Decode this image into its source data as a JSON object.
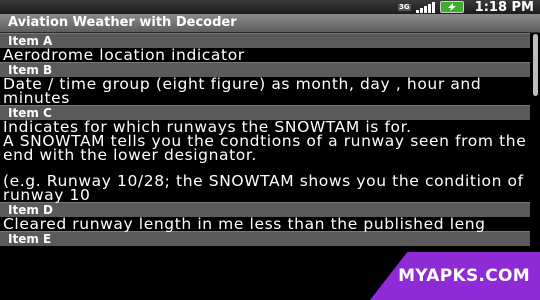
{
  "status_bar": {
    "network_label": "3G",
    "time": "1:18 PM"
  },
  "app": {
    "title": "Aviation Weather with Decoder"
  },
  "sections": [
    {
      "header": "Item A",
      "paragraphs": [
        "Aerodrome location indicator"
      ]
    },
    {
      "header": "Item B",
      "paragraphs": [
        "Date / time group (eight figure) as month, day , hour and minutes"
      ]
    },
    {
      "header": "Item C",
      "paragraphs": [
        "Indicates for which runways the SNOWTAM is for.\nA SNOWTAM tells you the condtions of a runway seen from the end with the lower designator.",
        "(e.g. Runway 10/28; the SNOWTAM shows you the condition of runway 10"
      ]
    },
    {
      "header": "Item D",
      "paragraphs": [
        "Cleared runway length in me less than the published leng"
      ]
    },
    {
      "header": "Item E",
      "paragraphs": []
    }
  ],
  "watermark": {
    "text": "MYAPKS.COM"
  },
  "colors": {
    "battery": "#3cae2c",
    "watermark": "#8e2bd6"
  }
}
